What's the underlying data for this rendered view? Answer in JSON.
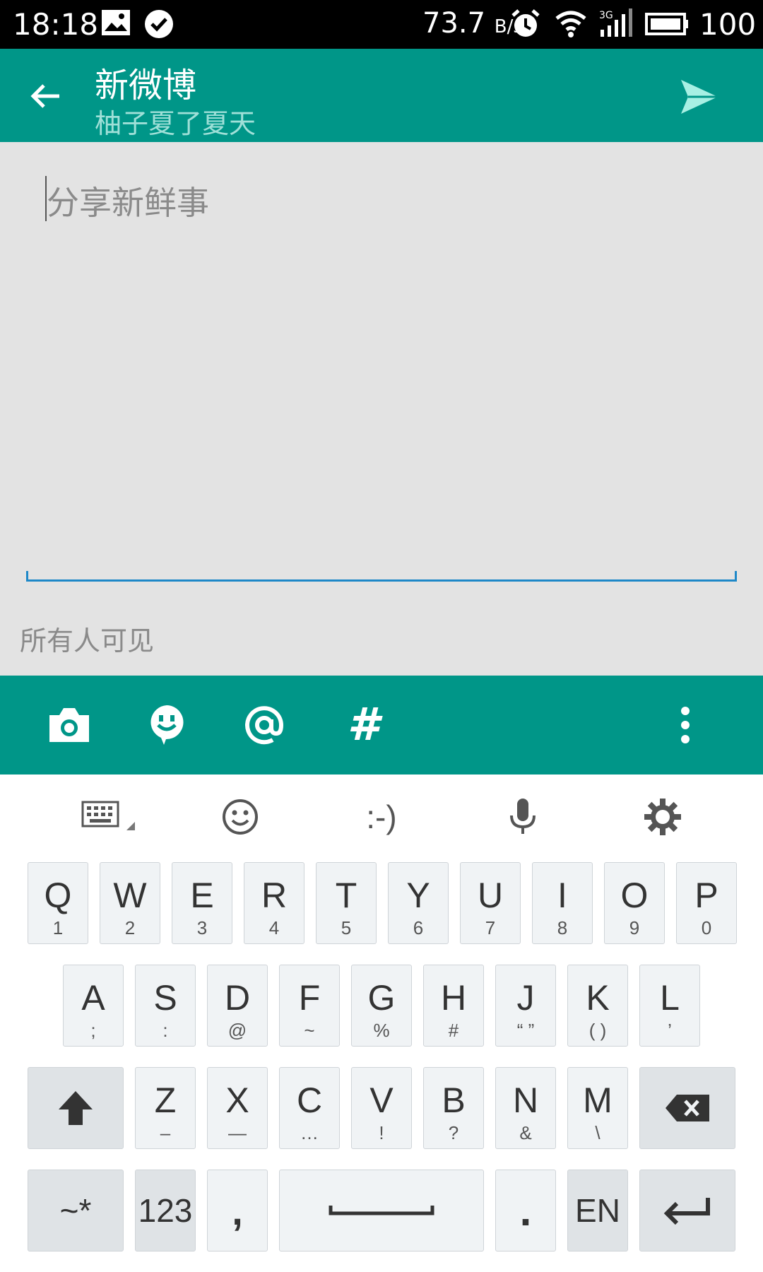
{
  "status_bar": {
    "time": "18:18",
    "net_speed": "73.7",
    "net_unit": "B/s",
    "battery": "100"
  },
  "app_bar": {
    "title": "新微博",
    "subtitle": "柚子夏了夏天"
  },
  "compose": {
    "placeholder": "分享新鲜事",
    "visibility": "所有人可见"
  },
  "toolbar": {
    "hash": "#"
  },
  "keyboard": {
    "suggest_emoticon": ":-)",
    "row1": [
      {
        "main": "Q",
        "sub": "1"
      },
      {
        "main": "W",
        "sub": "2"
      },
      {
        "main": "E",
        "sub": "3"
      },
      {
        "main": "R",
        "sub": "4"
      },
      {
        "main": "T",
        "sub": "5"
      },
      {
        "main": "Y",
        "sub": "6"
      },
      {
        "main": "U",
        "sub": "7"
      },
      {
        "main": "I",
        "sub": "8"
      },
      {
        "main": "O",
        "sub": "9"
      },
      {
        "main": "P",
        "sub": "0"
      }
    ],
    "row2": [
      {
        "main": "A",
        "sub": ";"
      },
      {
        "main": "S",
        "sub": ":"
      },
      {
        "main": "D",
        "sub": "@"
      },
      {
        "main": "F",
        "sub": "~"
      },
      {
        "main": "G",
        "sub": "%"
      },
      {
        "main": "H",
        "sub": "#"
      },
      {
        "main": "J",
        "sub": "“ ”"
      },
      {
        "main": "K",
        "sub": "( )"
      },
      {
        "main": "L",
        "sub": "’"
      }
    ],
    "row3": [
      {
        "main": "Z",
        "sub": "–"
      },
      {
        "main": "X",
        "sub": "—"
      },
      {
        "main": "C",
        "sub": "…"
      },
      {
        "main": "V",
        "sub": "!"
      },
      {
        "main": "B",
        "sub": "?"
      },
      {
        "main": "N",
        "sub": "&"
      },
      {
        "main": "M",
        "sub": "\\"
      }
    ],
    "symbols_key": "~*",
    "numbers_key": "123",
    "comma_key": ",",
    "period_key": ".",
    "language_key": "EN"
  },
  "colors": {
    "accent": "#009688",
    "input_underline": "#1e88c8"
  }
}
